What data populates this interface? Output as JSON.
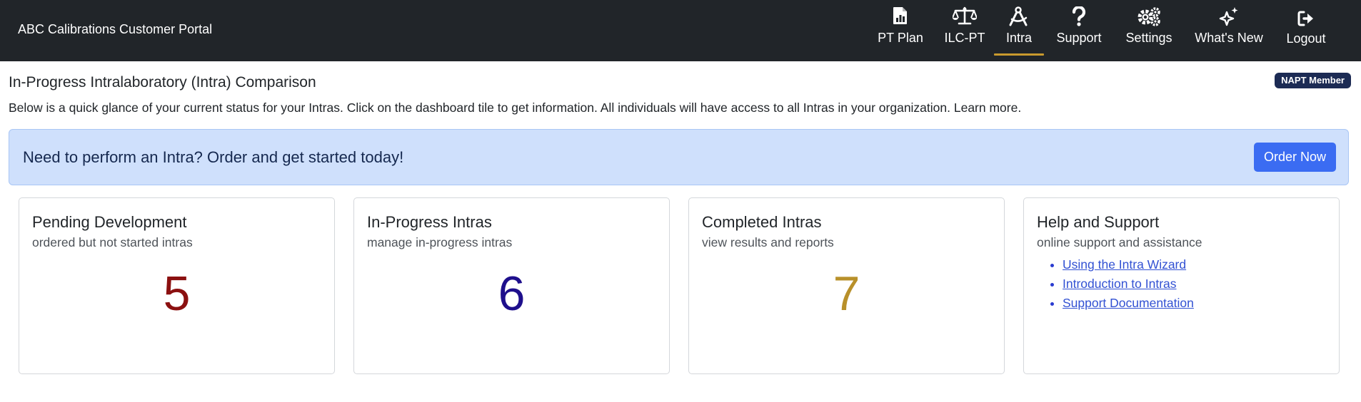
{
  "app": {
    "brand": "ABC Calibrations Customer Portal"
  },
  "nav": {
    "items": [
      {
        "label": "PT Plan",
        "icon": "file-chart-icon",
        "active": false
      },
      {
        "label": "ILC-PT",
        "icon": "scale-icon",
        "active": false
      },
      {
        "label": "Intra",
        "icon": "drafting-compass-icon",
        "active": true
      },
      {
        "label": "Support",
        "icon": "question-icon",
        "active": false
      },
      {
        "label": "Settings",
        "icon": "gears-icon",
        "active": false
      },
      {
        "label": "What's New",
        "icon": "sparkles-icon",
        "active": false
      },
      {
        "label": "Logout",
        "icon": "logout-icon",
        "active": false
      }
    ],
    "active_color": "#c99a2e"
  },
  "header": {
    "title": "In-Progress Intralaboratory (Intra) Comparison",
    "badge": "NAPT Member",
    "intro": "Below is a quick glance of your current status for your Intras. Click on the dashboard tile to get information. All individuals will have access to all Intras in your organization. Learn more."
  },
  "banner": {
    "text": "Need to perform an Intra? Order and get started today!",
    "button_label": "Order Now"
  },
  "cards": [
    {
      "title": "Pending Development",
      "subtitle": "ordered but not started intras",
      "count": "5",
      "color": "#8b1010"
    },
    {
      "title": "In-Progress Intras",
      "subtitle": "manage in-progress intras",
      "count": "6",
      "color": "#1e0f8c"
    },
    {
      "title": "Completed Intras",
      "subtitle": "view results and reports",
      "count": "7",
      "color": "#b8902a"
    }
  ],
  "help": {
    "title": "Help and Support",
    "subtitle": "online support and assistance",
    "links": [
      "Using the Intra Wizard",
      "Introduction to Intras",
      "Support Documentation"
    ]
  }
}
